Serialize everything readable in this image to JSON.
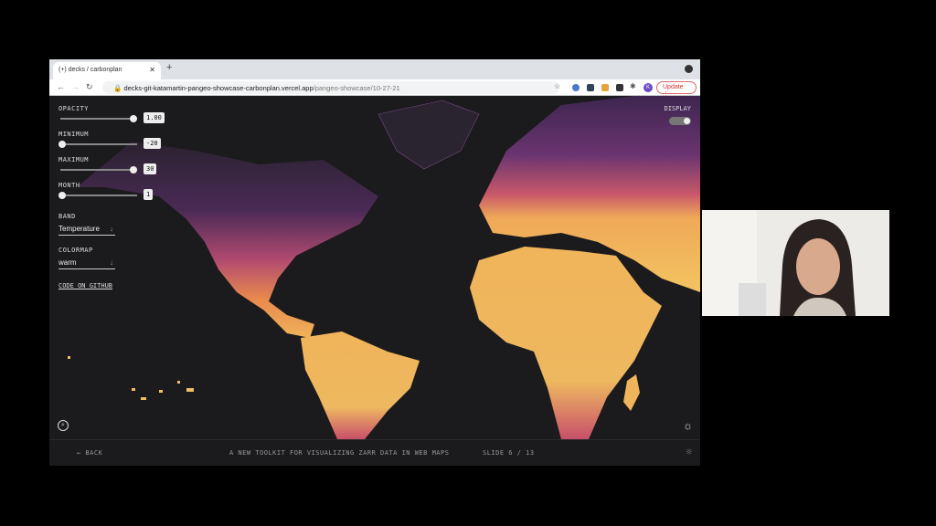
{
  "browser": {
    "tab_title": "decks / carbonplan",
    "tab_icon": "(+)",
    "url_host": "decks-git-katamartin-pangeo-showcase-carbonplan.vercel.app",
    "url_path": "/pangeo-showcase/10-27-21",
    "update_label": "Update",
    "profile_initial": "K"
  },
  "controls": {
    "opacity": {
      "label": "OPACITY",
      "value": "1.00",
      "fraction": 1.0
    },
    "minimum": {
      "label": "MINIMUM",
      "value": "-20",
      "fraction": 0.0
    },
    "maximum": {
      "label": "MAXIMUM",
      "value": "30",
      "fraction": 1.0
    },
    "month": {
      "label": "MONTH",
      "value": "1",
      "fraction": 0.0
    },
    "band": {
      "label": "BAND",
      "value": "Temperature"
    },
    "colormap": {
      "label": "COLORMAP",
      "value": "warm"
    },
    "github_link": "CODE ON GITHUB",
    "display_label": "DISPLAY"
  },
  "footer": {
    "back": "← BACK",
    "title": "A NEW TOOLKIT FOR VISUALIZING ZARR DATA IN WEB MAPS",
    "slide": "SLIDE 6 / 13"
  },
  "colors": {
    "warm_low": "#5a2a6a",
    "warm_mid": "#d9506a",
    "warm_high": "#f2c25a",
    "background": "#1b1a1c"
  }
}
